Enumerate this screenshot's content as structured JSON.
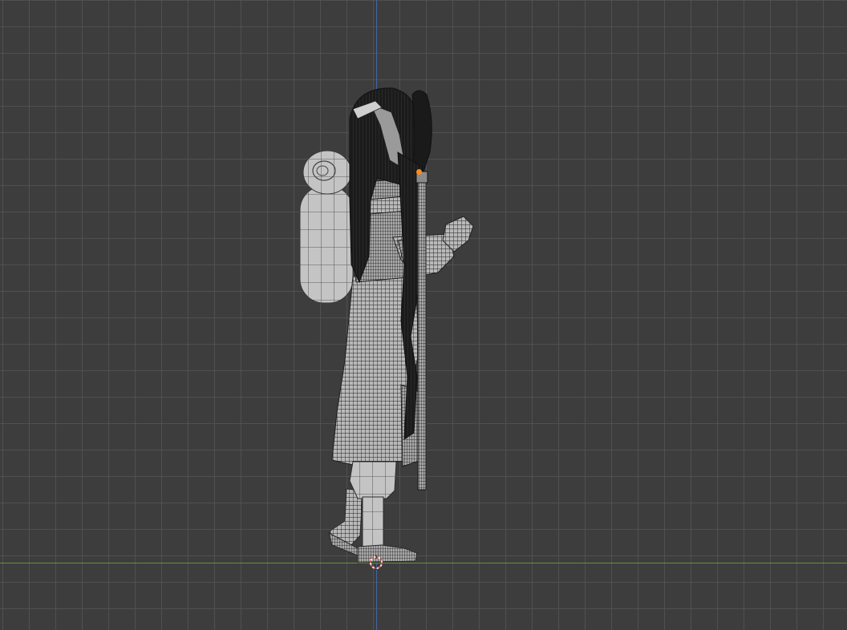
{
  "viewport": {
    "view": "side-orthographic",
    "background_color": "#3d3d3d",
    "grid_color": "#525252",
    "axis_colors": {
      "vertical": "#3f68a8",
      "horizontal": "#6c8f3a"
    }
  },
  "model": {
    "display": "wireframe-overlay",
    "shade_color": "#bdbdbd",
    "wire_color": "#1e1e1e"
  },
  "icons": {
    "origin": "origin-dot-icon",
    "cursor": "3d-cursor-icon"
  },
  "accent_colors": {
    "origin": "#ff8a1f",
    "cursor_red": "#e0453a"
  }
}
